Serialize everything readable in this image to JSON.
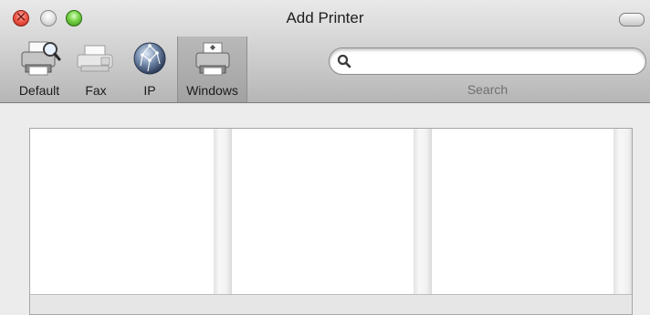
{
  "window": {
    "title": "Add Printer"
  },
  "toolbar": {
    "items": [
      {
        "label": "Default",
        "icon": "default-printer-icon"
      },
      {
        "label": "Fax",
        "icon": "fax-icon"
      },
      {
        "label": "IP",
        "icon": "network-globe-icon"
      },
      {
        "label": "Windows",
        "icon": "windows-printer-icon",
        "selected": true
      }
    ]
  },
  "search": {
    "placeholder": "",
    "value": "",
    "label": "Search"
  },
  "colors": {
    "toolbar_top": "#e9e9e9",
    "toolbar_bottom": "#b6b6b6",
    "close": "#f25b4c",
    "zoom": "#74d144"
  }
}
